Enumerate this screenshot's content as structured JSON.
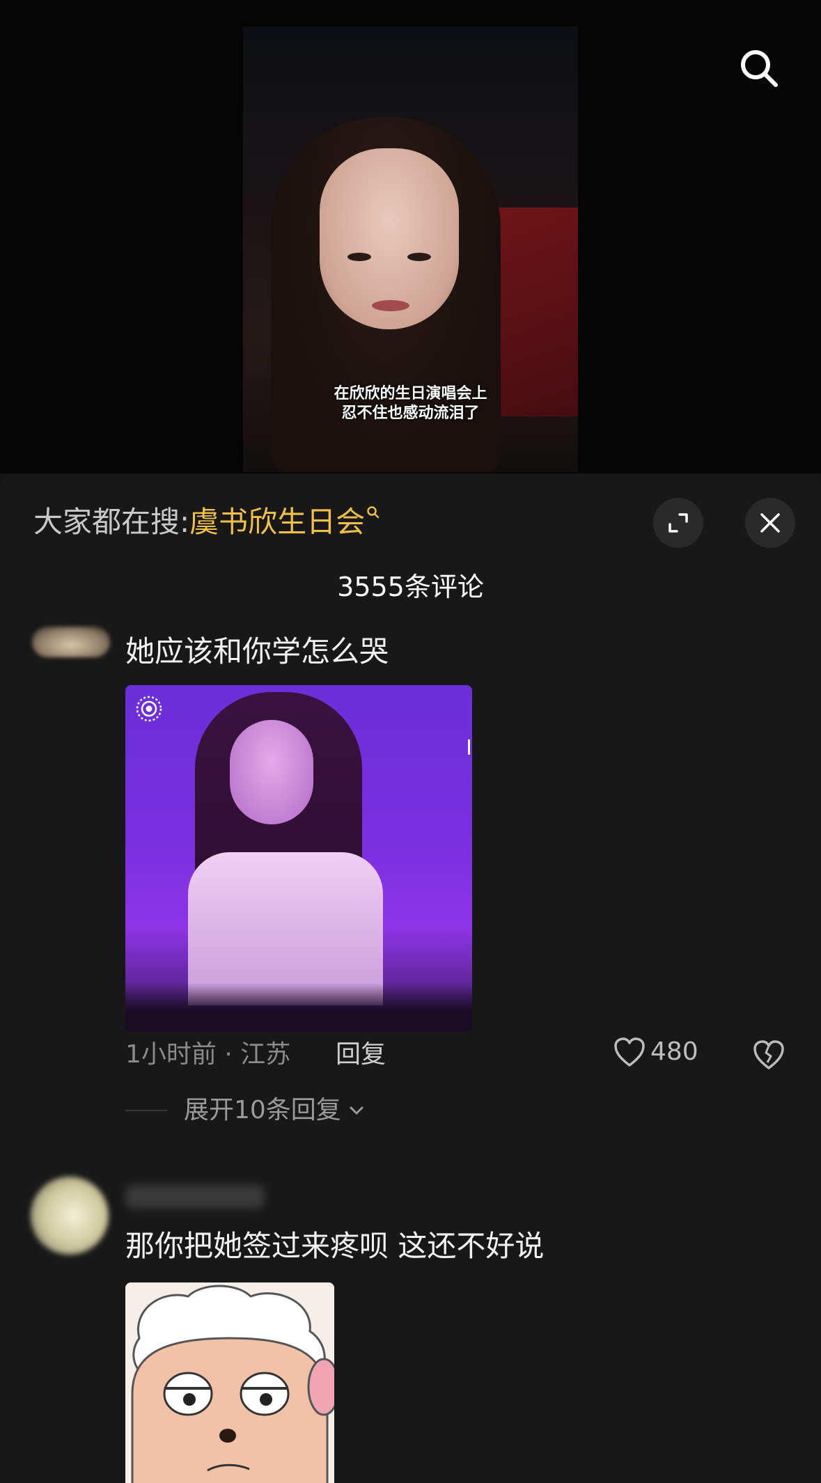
{
  "video": {
    "caption_line1": "在欣欣的生日演唱会上",
    "caption_line2": "忍不住也感动流泪了"
  },
  "header": {
    "search_icon": "search-icon"
  },
  "comments_panel": {
    "hot_search_prefix": "大家都在搜:",
    "hot_search_keyword": "虞书欣生日会",
    "keyword_color": "#f0c04a",
    "expand_icon": "expand-icon",
    "close_icon": "close-icon",
    "count_title": "3555条评论"
  },
  "comments": [
    {
      "text": "她应该和你学怎么哭",
      "time_location": "1小时前 · 江苏",
      "reply_label": "回复",
      "like_count": "480",
      "expand_replies_label": "展开10条回复"
    },
    {
      "text": "那你把她签过来疼呗 这还不好说"
    }
  ]
}
